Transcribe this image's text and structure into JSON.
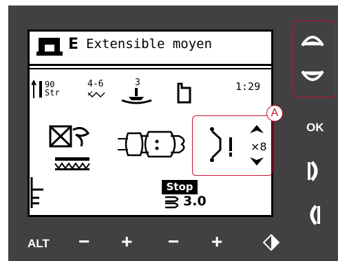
{
  "display": {
    "stitch_letter": "E",
    "stitch_name": "Extensible moyen",
    "needle": {
      "size": "90",
      "type": "Str"
    },
    "stitch_width": "4-6",
    "thread_tension": "3",
    "time": "1:29",
    "repeat_count": "×8",
    "stop_label": "Stop",
    "stitch_length": "3.0"
  },
  "callout": {
    "label": "A"
  },
  "buttons": {
    "ok": "OK",
    "alt": "ALT",
    "minus_1": "−",
    "plus_1": "+",
    "minus_2": "−",
    "plus_2": "+"
  },
  "colors": {
    "panel": "#414042",
    "accent": "#c8102e",
    "lcd_background": "#ffffff",
    "lcd_foreground": "#000000"
  }
}
